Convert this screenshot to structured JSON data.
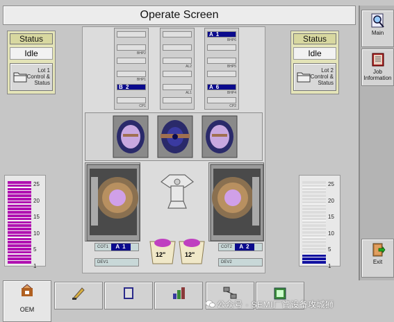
{
  "title": "Operate Screen",
  "side_panel": {
    "main_label": "Main",
    "job_info_label": "Job Information",
    "exit_label": "Exit"
  },
  "status_left": {
    "header": "Status",
    "value": "Idle",
    "lot_label": "Lot 1 Control & Status"
  },
  "status_right": {
    "header": "Status",
    "value": "Idle",
    "lot_label": "Lot 2 Control & Status"
  },
  "buffers": {
    "left": [
      {
        "label": "",
        "wafer": ""
      },
      {
        "label": "BHP2",
        "wafer": ""
      },
      {
        "label": "",
        "wafer": ""
      },
      {
        "label": "BHP1",
        "wafer": ""
      },
      {
        "label": "",
        "wafer": "B 2"
      },
      {
        "label": "CP1",
        "wafer": ""
      }
    ],
    "middle": [
      {
        "label": "",
        "wafer": ""
      },
      {
        "label": "",
        "wafer": ""
      },
      {
        "label": "AL2",
        "wafer": ""
      },
      {
        "label": "",
        "wafer": ""
      },
      {
        "label": "AL1",
        "wafer": ""
      },
      {
        "label": "",
        "wafer": ""
      }
    ],
    "right": [
      {
        "label": "BHP6",
        "wafer": "A 1"
      },
      {
        "label": "",
        "wafer": ""
      },
      {
        "label": "BHP5",
        "wafer": ""
      },
      {
        "label": "",
        "wafer": ""
      },
      {
        "label": "BHP4",
        "wafer": "A 6"
      },
      {
        "label": "CP2",
        "wafer": ""
      }
    ]
  },
  "coaters": {
    "left": {
      "cot_label": "COT1",
      "cot_tag": "A 1",
      "dev_label": "DEV1"
    },
    "right": {
      "cot_label": "COT2",
      "cot_tag": "A 2",
      "dev_label": "DEV2"
    }
  },
  "cassettes": {
    "left": "12\"",
    "right": "12\""
  },
  "gauges": {
    "ticks": [
      "25",
      "20",
      "15",
      "10",
      "5",
      "1"
    ],
    "left": {
      "fill_count": 25,
      "color": "#b010b0"
    },
    "right": {
      "fill_count": 3,
      "color": "#1010a0"
    }
  },
  "tabs": [
    {
      "label": "OEM",
      "icon": "oem-icon"
    },
    {
      "label": "",
      "icon": "recipe-icon"
    },
    {
      "label": "",
      "icon": "book-icon"
    },
    {
      "label": "",
      "icon": "data-icon"
    },
    {
      "label": "",
      "icon": "network-icon"
    },
    {
      "label": "",
      "icon": "gauge-icon"
    }
  ],
  "watermark": "公众号 · SEMI厂管设备攻城狮"
}
